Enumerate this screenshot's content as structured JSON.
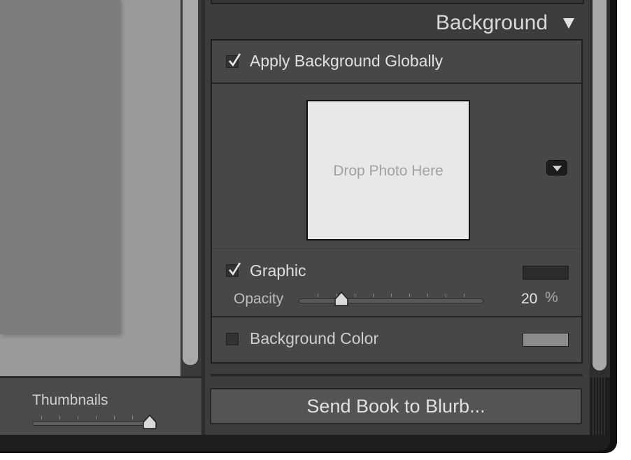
{
  "thumbnails": {
    "label": "Thumbnails",
    "value_fraction": 0.94
  },
  "background_panel": {
    "title": "Background",
    "collapse_icon": "triangle-down-icon",
    "apply_globally": {
      "label": "Apply Background Globally",
      "checked": true
    },
    "drop_placeholder": "Drop Photo Here",
    "dropdown_icon": "chevron-down-icon",
    "graphic": {
      "label": "Graphic",
      "checked": true,
      "swatch_color": "#2c2c2c"
    },
    "opacity": {
      "label": "Opacity",
      "value": "20",
      "unit": "%"
    },
    "background_color": {
      "label": "Background Color",
      "checked": false,
      "swatch_color": "#8c8c8c"
    }
  },
  "send_button": {
    "label": "Send Book to Blurb..."
  }
}
